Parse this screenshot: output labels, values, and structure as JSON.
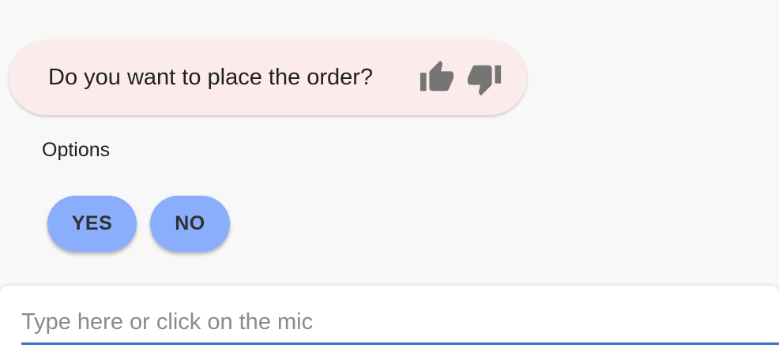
{
  "message": {
    "text": "Do you want to place the order?",
    "thumbs_up_icon": "thumbs-up-icon",
    "thumbs_down_icon": "thumbs-down-icon"
  },
  "options": {
    "label": "Options",
    "buttons": [
      {
        "label": "YES"
      },
      {
        "label": "NO"
      }
    ]
  },
  "input": {
    "placeholder": "Type here or click on the mic",
    "value": ""
  },
  "colors": {
    "bubble_bg": "#fcebeb",
    "option_button_bg": "#8aaefc",
    "input_underline": "#3a72c8",
    "icon": "#757575"
  }
}
